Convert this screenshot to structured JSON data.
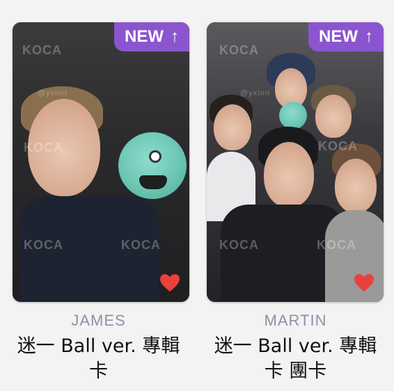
{
  "cards": [
    {
      "badge": {
        "label": "NEW",
        "icon": "arrow-up-icon",
        "color": "#8b55cf"
      },
      "watermarks": [
        "KOCA",
        "KOCA",
        "KOCA",
        "KOCA",
        "@yxinn"
      ],
      "member": "JAMES",
      "title_line1": "迷一 Ball ver. 專輯",
      "title_line2": "卡",
      "favorite": {
        "icon": "heart-icon",
        "color": "#e8413e"
      }
    },
    {
      "badge": {
        "label": "NEW",
        "icon": "arrow-up-icon",
        "color": "#8b55cf"
      },
      "watermarks": [
        "KOCA",
        "KOCA",
        "KOCA",
        "KOCA",
        "@yxinn"
      ],
      "member": "MARTIN",
      "title_line1": "迷一 Ball ver. 專輯",
      "title_line2": "卡 團卡",
      "favorite": {
        "icon": "heart-icon",
        "color": "#e8413e"
      }
    }
  ]
}
